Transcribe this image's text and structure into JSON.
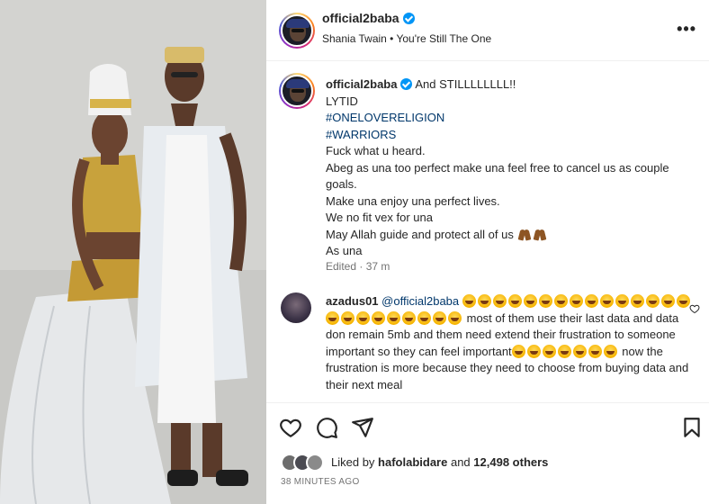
{
  "post": {
    "username": "official2baba",
    "audio": "Shania Twain • You're Still The One",
    "more_icon": "more-options-icon"
  },
  "caption": {
    "username": "official2baba",
    "lines": [
      "And STILLLLLLLL!!",
      "LYTID",
      "#ONELOVERELIGION",
      "#WARRIORS",
      "Fuck what u heard.",
      "Abeg as una too perfect make una feel free to cancel us as couple goals.",
      "Make una enjoy una perfect lives.",
      "We no fit vex for una",
      "May Allah guide and protect all of us",
      "As una"
    ],
    "edited": "Edited · 37 m"
  },
  "comment": {
    "username": "azadus01",
    "mention": "@official2baba",
    "text_1": "most of them use their last data and data don remain 5mb and them need extend their frustration to someone important so they can feel important",
    "text_2": "now the frustration is more because they need to choose from buying data and their next meal",
    "emoji_name": "laughing-emoji"
  },
  "likes": {
    "prefix": "Liked by",
    "user": "hafolabidare",
    "connector": "and",
    "others": "12,498 others"
  },
  "timestamp": "38 MINUTES AGO",
  "colors": {
    "link": "#00376b",
    "verified": "#0095f6",
    "text": "#262626",
    "muted": "#737373"
  }
}
